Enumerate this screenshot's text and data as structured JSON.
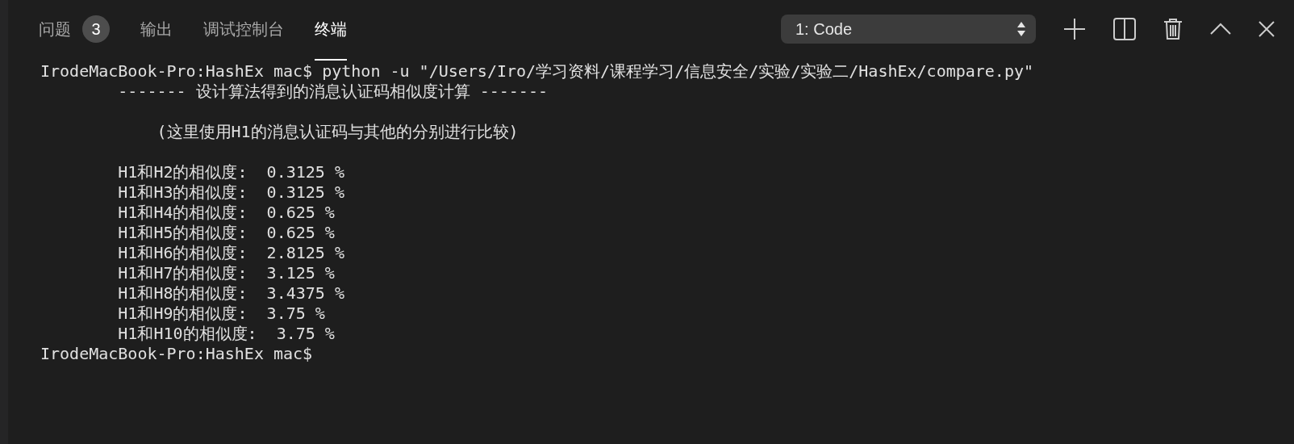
{
  "tabs": [
    {
      "label": "问题",
      "badge": "3",
      "selected": false
    },
    {
      "label": "输出",
      "selected": false
    },
    {
      "label": "调试控制台",
      "selected": false
    },
    {
      "label": "终端",
      "selected": true
    }
  ],
  "terminal_selector": {
    "value": "1: Code"
  },
  "terminal": {
    "blocks": [
      [
        "IrodeMacBook-Pro:HashEx mac$ python -u \"/Users/Iro/学习资料/课程学习/信息安全/实验/实验二/HashEx/compare.py\"",
        "        ------- 设计算法得到的消息认证码相似度计算 -------"
      ],
      [
        "            (这里使用H1的消息认证码与其他的分别进行比较)"
      ],
      [
        "        H1和H2的相似度:  0.3125 %",
        "        H1和H3的相似度:  0.3125 %",
        "        H1和H4的相似度:  0.625 %",
        "        H1和H5的相似度:  0.625 %",
        "        H1和H6的相似度:  2.8125 %",
        "        H1和H7的相似度:  3.125 %",
        "        H1和H8的相似度:  3.4375 %",
        "        H1和H9的相似度:  3.75 %",
        "        H1和H10的相似度:  3.75 %",
        "IrodeMacBook-Pro:HashEx mac$"
      ]
    ]
  }
}
